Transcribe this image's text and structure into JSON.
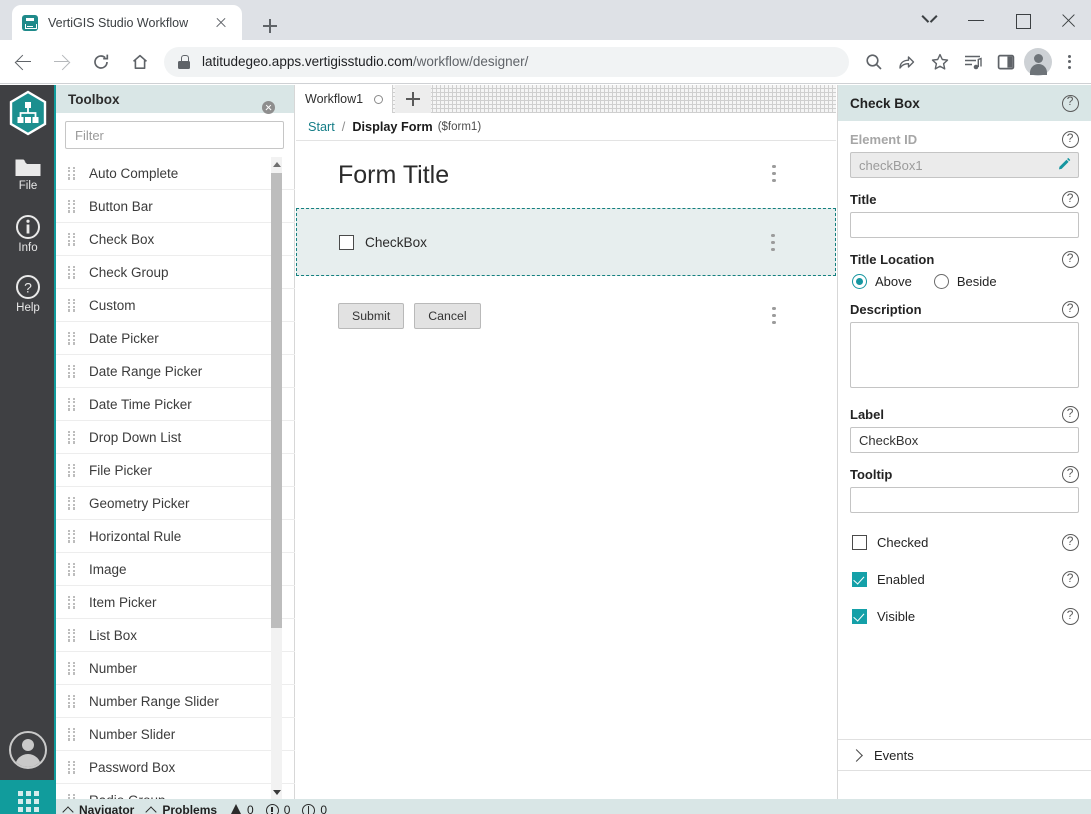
{
  "browser": {
    "tab_title": "VertiGIS Studio Workflow",
    "url_main": "latitudegeo.apps.vertigisstudio.com",
    "url_path": "/workflow/designer/",
    "icons": {
      "favicon": "vertigis-logo-icon",
      "close_tab": "close-icon",
      "new_tab": "plus-icon",
      "back": "back-arrow-icon",
      "forward": "forward-arrow-icon",
      "reload": "reload-icon",
      "home": "home-icon",
      "lock": "lock-icon",
      "zoom": "search-icon",
      "share": "share-icon",
      "bookmark": "star-icon",
      "reading_list": "reading-list-icon",
      "side_panel": "side-panel-icon",
      "profile": "profile-avatar-icon",
      "menu": "kebab-menu-icon",
      "minimize": "minimize-icon",
      "maximize": "maximize-icon",
      "window_close": "close-icon",
      "chevron_down": "chevron-down-icon"
    }
  },
  "rail": {
    "logo": "vertigis-workflow-logo",
    "items": [
      {
        "label": "File",
        "icon": "folder-icon"
      },
      {
        "label": "Info",
        "icon": "info-circle-icon"
      },
      {
        "label": "Help",
        "icon": "question-circle-icon"
      }
    ],
    "avatar": "user-avatar-icon",
    "app_grid": "app-grid-icon"
  },
  "toolbox": {
    "title": "Toolbox",
    "filter_placeholder": "Filter",
    "filter_value": "",
    "clear_icon": "clear-circle-icon",
    "items": [
      "Auto Complete",
      "Button Bar",
      "Check Box",
      "Check Group",
      "Custom",
      "Date Picker",
      "Date Range Picker",
      "Date Time Picker",
      "Drop Down List",
      "File Picker",
      "Geometry Picker",
      "Horizontal Rule",
      "Image",
      "Item Picker",
      "List Box",
      "Number",
      "Number Range Slider",
      "Number Slider",
      "Password Box",
      "Radio Group"
    ]
  },
  "designer": {
    "tab": {
      "label": "Workflow1",
      "status_icon": "unsaved-circle-icon"
    },
    "add_tab_icon": "plus-icon",
    "breadcrumb": {
      "root": "Start",
      "separator": "/",
      "current": "Display Form",
      "variable": "($form1)"
    },
    "form": {
      "title": "Form Title",
      "checkbox": {
        "label": "CheckBox",
        "checked": false
      },
      "buttons": [
        "Submit",
        "Cancel"
      ],
      "menu_icon": "vertical-dots-icon"
    }
  },
  "properties": {
    "header_title": "Check Box",
    "help_icon": "help-circle-icon",
    "element_id": {
      "label": "Element ID",
      "value": "checkBox1",
      "edit_icon": "pencil-icon"
    },
    "title": {
      "label": "Title",
      "value": ""
    },
    "title_location": {
      "label": "Title Location",
      "options": [
        "Above",
        "Beside"
      ],
      "selected": "Above"
    },
    "description": {
      "label": "Description",
      "value": ""
    },
    "label_field": {
      "label": "Label",
      "value": "CheckBox"
    },
    "tooltip": {
      "label": "Tooltip",
      "value": ""
    },
    "checkboxes": [
      {
        "label": "Checked",
        "checked": false
      },
      {
        "label": "Enabled",
        "checked": true
      },
      {
        "label": "Visible",
        "checked": true
      }
    ],
    "events": {
      "label": "Events",
      "expand_icon": "chevron-right-icon"
    }
  },
  "statusbar": {
    "navigator": "Navigator",
    "problems": "Problems",
    "errors": "0",
    "warnings": "0",
    "infos": "0",
    "icons": {
      "navigator_chevron": "chevron-up-icon",
      "problems_chevron": "chevron-up-icon",
      "warning": "warning-triangle-icon",
      "error": "error-circle-icon",
      "info": "info-circle-icon"
    }
  },
  "colors": {
    "accent_teal": "#119c9c",
    "panel_header": "#d9e6e6",
    "rail_dark": "#3f4043",
    "selection_border": "#14807f",
    "selection_fill": "#e7eeee",
    "link": "#147d87"
  }
}
